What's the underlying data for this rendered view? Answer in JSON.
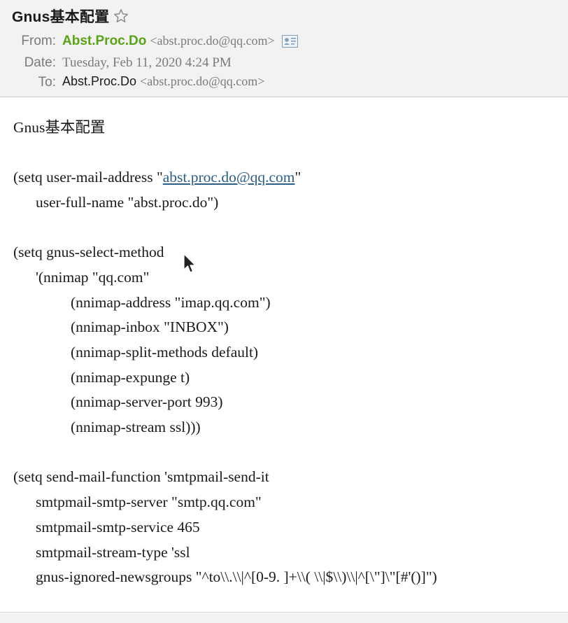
{
  "header": {
    "subject": "Gnus基本配置",
    "from_label": "From:",
    "from_name": "Abst.Proc.Do",
    "from_address": "<abst.proc.do@qq.com>",
    "date_label": "Date:",
    "date_value": "Tuesday, Feb 11, 2020 4:24 PM",
    "to_label": "To:",
    "to_name": "Abst.Proc.Do",
    "to_address": "<abst.proc.do@qq.com>",
    "icons": [
      "star-icon",
      "contact-card-icon"
    ]
  },
  "body": {
    "l0": "Gnus基本配置",
    "l1_pre": "(setq user-mail-address \"",
    "l1_link": "abst.proc.do@qq.com",
    "l1_post": "\"",
    "l2": "user-full-name \"abst.proc.do\")",
    "l3": "(setq gnus-select-method",
    "l4": "'(nnimap \"qq.com\"",
    "l5": "(nnimap-address \"imap.qq.com\")",
    "l6": "(nnimap-inbox \"INBOX\")",
    "l7": "(nnimap-split-methods default)",
    "l8": "(nnimap-expunge t)",
    "l9": "(nnimap-server-port 993)",
    "l10": "(nnimap-stream ssl)))",
    "l11": "(setq send-mail-function 'smtpmail-send-it",
    "l12": "smtpmail-smtp-server \"smtp.qq.com\"",
    "l13": "smtpmail-smtp-service 465",
    "l14": "smtpmail-stream-type 'ssl",
    "l15": "gnus-ignored-newsgroups \"^to\\\\.\\\\|^[0-9. ]+\\\\( \\\\|$\\\\)\\\\|^[\\\"]\\\"[#'()]\")"
  },
  "colors": {
    "sender": "#5aa316",
    "link": "#2c5e84",
    "header_bg": "#f2f2f3"
  }
}
